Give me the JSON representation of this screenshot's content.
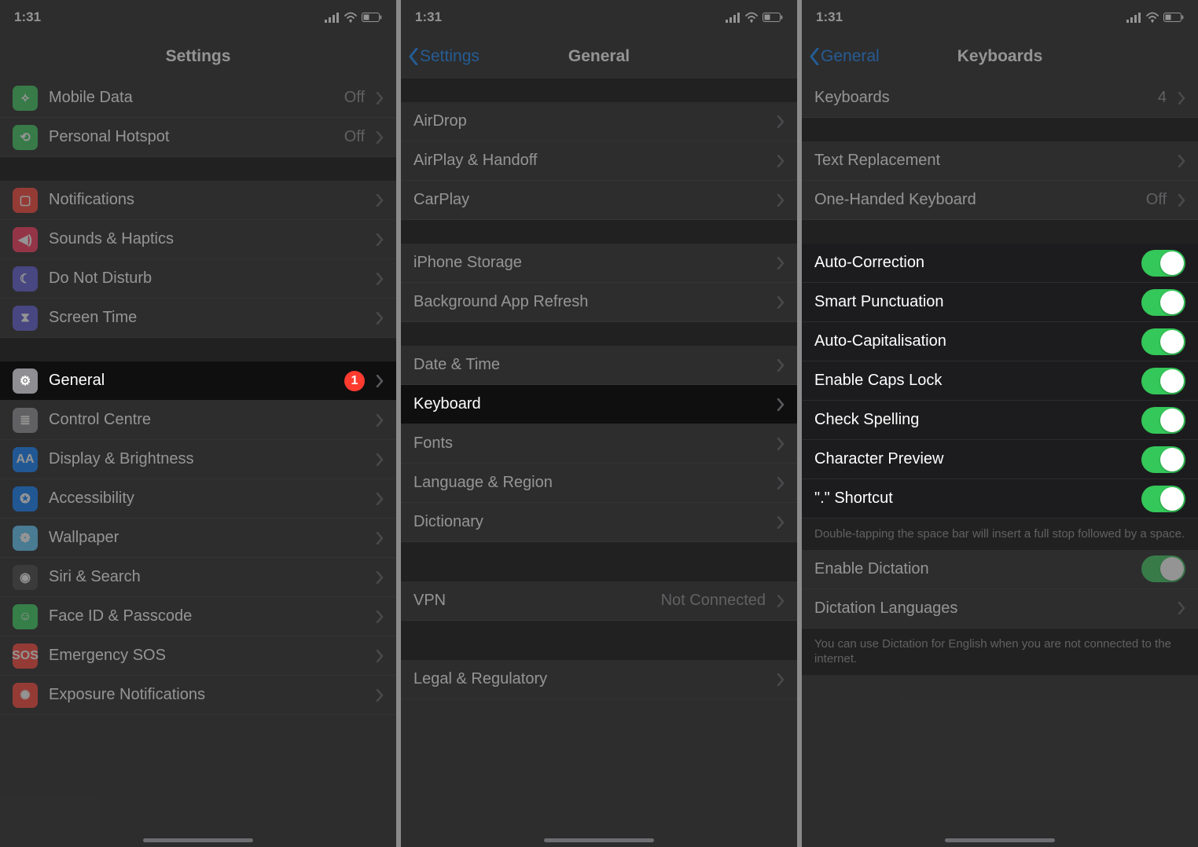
{
  "time": "1:31",
  "screens": {
    "settings": {
      "title": "Settings",
      "rows": [
        {
          "id": "mobile-data",
          "icon": "antenna-icon",
          "iconBg": "ic-green",
          "label": "Mobile Data",
          "value": "Off"
        },
        {
          "id": "hotspot",
          "icon": "link-icon",
          "iconBg": "ic-green",
          "label": "Personal Hotspot",
          "value": "Off"
        }
      ],
      "rows2": [
        {
          "id": "notifications",
          "icon": "bell-icon",
          "iconBg": "ic-red",
          "label": "Notifications"
        },
        {
          "id": "sounds",
          "icon": "speaker-icon",
          "iconBg": "ic-pink",
          "label": "Sounds & Haptics"
        },
        {
          "id": "dnd",
          "icon": "moon-icon",
          "iconBg": "ic-purple",
          "label": "Do Not Disturb"
        },
        {
          "id": "screentime",
          "icon": "hourglass-icon",
          "iconBg": "ic-purple",
          "label": "Screen Time"
        }
      ],
      "rows3": [
        {
          "id": "general",
          "icon": "gear-icon",
          "iconBg": "ic-grey",
          "label": "General",
          "badge": "1",
          "hl": true
        },
        {
          "id": "control-centre",
          "icon": "toggles-icon",
          "iconBg": "ic-grey",
          "label": "Control Centre"
        },
        {
          "id": "display",
          "icon": "text-size-icon",
          "iconBg": "ic-blue",
          "label": "Display & Brightness"
        },
        {
          "id": "accessibility",
          "icon": "person-icon",
          "iconBg": "ic-blue",
          "label": "Accessibility"
        },
        {
          "id": "wallpaper",
          "icon": "flower-icon",
          "iconBg": "ic-teal",
          "label": "Wallpaper"
        },
        {
          "id": "siri",
          "icon": "siri-icon",
          "iconBg": "ic-dark",
          "label": "Siri & Search"
        },
        {
          "id": "faceid",
          "icon": "faceid-icon",
          "iconBg": "ic-lime",
          "label": "Face ID & Passcode"
        },
        {
          "id": "sos",
          "icon": "sos-icon",
          "iconBg": "ic-red",
          "label": "Emergency SOS"
        },
        {
          "id": "exposure",
          "icon": "exposure-icon",
          "iconBg": "ic-red",
          "label": "Exposure Notifications"
        }
      ]
    },
    "general": {
      "back": "Settings",
      "title": "General",
      "g1": [
        {
          "id": "airdrop",
          "label": "AirDrop"
        },
        {
          "id": "airplay",
          "label": "AirPlay & Handoff"
        },
        {
          "id": "carplay",
          "label": "CarPlay"
        }
      ],
      "g2": [
        {
          "id": "storage",
          "label": "iPhone Storage"
        },
        {
          "id": "refresh",
          "label": "Background App Refresh"
        }
      ],
      "g3": [
        {
          "id": "datetime",
          "label": "Date & Time"
        },
        {
          "id": "keyboard",
          "label": "Keyboard",
          "hl": true
        },
        {
          "id": "fonts",
          "label": "Fonts"
        },
        {
          "id": "langregion",
          "label": "Language & Region"
        },
        {
          "id": "dictionary",
          "label": "Dictionary"
        }
      ],
      "g4": [
        {
          "id": "vpn",
          "label": "VPN",
          "value": "Not Connected"
        }
      ],
      "g5": [
        {
          "id": "legal",
          "label": "Legal & Regulatory"
        }
      ]
    },
    "keyboards": {
      "back": "General",
      "title": "Keyboards",
      "k1": [
        {
          "id": "keyboards-list",
          "label": "Keyboards",
          "value": "4"
        }
      ],
      "k2": [
        {
          "id": "text-repl",
          "label": "Text Replacement"
        },
        {
          "id": "onehand",
          "label": "One-Handed Keyboard",
          "value": "Off"
        }
      ],
      "toggles": [
        {
          "id": "auto-correct",
          "label": "Auto-Correction",
          "on": true
        },
        {
          "id": "smart-punct",
          "label": "Smart Punctuation",
          "on": true
        },
        {
          "id": "auto-cap",
          "label": "Auto-Capitalisation",
          "on": true
        },
        {
          "id": "caps-lock",
          "label": "Enable Caps Lock",
          "on": true
        },
        {
          "id": "spell",
          "label": "Check Spelling",
          "on": true
        },
        {
          "id": "char-preview",
          "label": "Character Preview",
          "on": true
        },
        {
          "id": "dot-shortcut",
          "label": "\".\" Shortcut",
          "on": true
        }
      ],
      "toggles_foot": "Double-tapping the space bar will insert a full stop followed by a space.",
      "k3": [
        {
          "id": "dictation",
          "label": "Enable Dictation",
          "toggle": true,
          "on": true
        },
        {
          "id": "dict-lang",
          "label": "Dictation Languages"
        }
      ],
      "dict_foot": "You can use Dictation for English when you are not connected to the internet."
    }
  }
}
